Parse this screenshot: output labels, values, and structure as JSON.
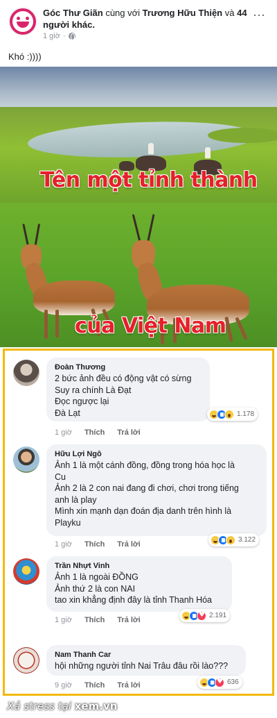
{
  "post": {
    "page_name": "Góc Thư Giãn",
    "with_text": "cùng với",
    "tagged_user": "Trương Hữu Thiện",
    "and_text": "và",
    "others_text": "44 người khác.",
    "time": "1 giờ",
    "separator": "·",
    "more_icon": "⋯",
    "caption": "Khó :))))"
  },
  "image": {
    "text_top": "Tên một tỉnh thành",
    "text_bottom": "của Việt Nam"
  },
  "comments": [
    {
      "name": "Đoàn Thương",
      "lines": [
        "2 bức ảnh đều có động vật có sừng",
        "Suy ra chính Là Đạt",
        "Đọc ngược lại",
        "Đà Lạt"
      ],
      "time": "1 giờ",
      "like": "Thích",
      "reply": "Trả lời",
      "reaction_icons": [
        "haha",
        "like",
        "wow"
      ],
      "reaction_count": "1.178"
    },
    {
      "name": "Hữu Lợi Ngô",
      "lines": [
        "Ảnh 1 là một cánh đồng, đồng trong hóa học là",
        "Cu",
        "Ảnh 2 là 2 con nai đang đi chơi, chơi trong tiếng",
        "anh là play",
        "Mình xin mạnh dạn đoán địa danh trên hình là",
        "Playku"
      ],
      "time": "1 giờ",
      "like": "Thích",
      "reply": "Trả lời",
      "reaction_icons": [
        "haha",
        "like",
        "wow"
      ],
      "reaction_count": "3.122"
    },
    {
      "name": "Trần Nhựt Vinh",
      "lines": [
        "Ảnh 1 là ngoài ĐỒNG",
        "Ảnh thứ 2 là con NAI",
        "tao xin khẳng định đây là tỉnh Thanh Hóa"
      ],
      "time": "1 giờ",
      "like": "Thích",
      "reply": "Trả lời",
      "reaction_icons": [
        "haha",
        "like",
        "love"
      ],
      "reaction_count": "2.191"
    },
    {
      "name": "Nam Thanh Car",
      "lines": [
        "hội những người tỉnh Nai Trâu đâu rồi lào???"
      ],
      "time": "9 giờ",
      "like": "Thích",
      "reply": "Trả lời",
      "reaction_icons": [
        "haha",
        "like",
        "love"
      ],
      "reaction_count": "636"
    }
  ],
  "watermark": {
    "prefix": "Xả stress tại",
    "site": "xem.vn"
  },
  "colors": {
    "highlight_border": "#f2b90c",
    "image_text": "#e5202a",
    "page_avatar": "#d9256b"
  }
}
